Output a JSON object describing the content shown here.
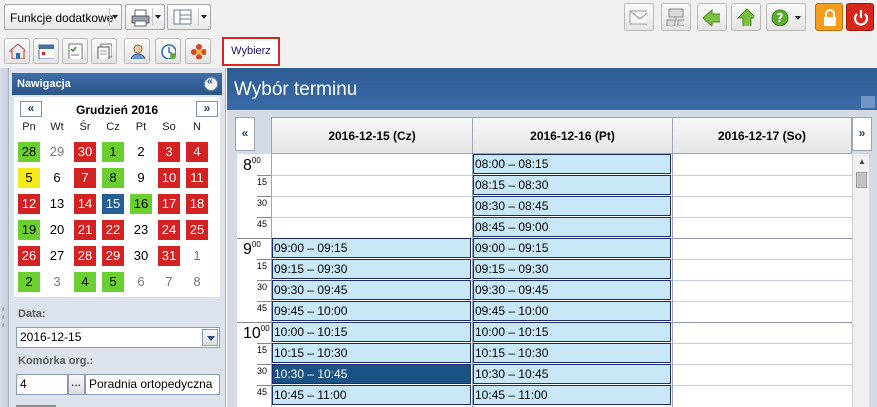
{
  "toolbar": {
    "functions_label": "Funkcje dodatkowe",
    "wybierz_label": "Wybierz"
  },
  "nav": {
    "header": "Nawigacja",
    "calendar": {
      "month_title": "Grudzień 2016",
      "prev": "«",
      "next": "»",
      "weekdays": [
        "Pn",
        "Wt",
        "Śr",
        "Cz",
        "Pt",
        "So",
        "N"
      ],
      "weeks": [
        [
          {
            "d": "28",
            "s": "green"
          },
          {
            "d": "29",
            "s": "other"
          },
          {
            "d": "30",
            "s": "red"
          },
          {
            "d": "1",
            "s": "green"
          },
          {
            "d": "2",
            "s": "plain"
          },
          {
            "d": "3",
            "s": "red"
          },
          {
            "d": "4",
            "s": "red"
          }
        ],
        [
          {
            "d": "5",
            "s": "yellow"
          },
          {
            "d": "6",
            "s": "plain"
          },
          {
            "d": "7",
            "s": "red"
          },
          {
            "d": "8",
            "s": "green"
          },
          {
            "d": "9",
            "s": "plain"
          },
          {
            "d": "10",
            "s": "red"
          },
          {
            "d": "11",
            "s": "red"
          }
        ],
        [
          {
            "d": "12",
            "s": "red"
          },
          {
            "d": "13",
            "s": "plain"
          },
          {
            "d": "14",
            "s": "red"
          },
          {
            "d": "15",
            "s": "sel"
          },
          {
            "d": "16",
            "s": "green"
          },
          {
            "d": "17",
            "s": "red"
          },
          {
            "d": "18",
            "s": "red"
          }
        ],
        [
          {
            "d": "19",
            "s": "green"
          },
          {
            "d": "20",
            "s": "plain"
          },
          {
            "d": "21",
            "s": "red"
          },
          {
            "d": "22",
            "s": "red"
          },
          {
            "d": "23",
            "s": "plain"
          },
          {
            "d": "24",
            "s": "red"
          },
          {
            "d": "25",
            "s": "red"
          }
        ],
        [
          {
            "d": "26",
            "s": "red"
          },
          {
            "d": "27",
            "s": "plain"
          },
          {
            "d": "28",
            "s": "red"
          },
          {
            "d": "29",
            "s": "red"
          },
          {
            "d": "30",
            "s": "plain"
          },
          {
            "d": "31",
            "s": "red"
          },
          {
            "d": "1",
            "s": "other"
          }
        ],
        [
          {
            "d": "2",
            "s": "green"
          },
          {
            "d": "3",
            "s": "other"
          },
          {
            "d": "4",
            "s": "green"
          },
          {
            "d": "5",
            "s": "green"
          },
          {
            "d": "6",
            "s": "other"
          },
          {
            "d": "7",
            "s": "other"
          },
          {
            "d": "8",
            "s": "other"
          }
        ]
      ]
    },
    "date_label": "Data:",
    "date_value": "2016-12-15",
    "unit_label": "Komórka org.:",
    "unit_code": "4",
    "unit_btn": "...",
    "unit_name": "Poradnia ortopedyczna"
  },
  "main": {
    "title": "Wybór terminu",
    "prev": "«",
    "next": "»",
    "columns": [
      {
        "date": "2016-12-15 (Cz)"
      },
      {
        "date": "2016-12-16 (Pt)"
      },
      {
        "date": "2016-12-17 (So)"
      }
    ],
    "hours": [
      {
        "h": "8",
        "m": "00"
      },
      {
        "h": "9",
        "m": "00"
      },
      {
        "h": "10",
        "m": "00"
      }
    ],
    "minutes": [
      "15",
      "30",
      "45"
    ],
    "col1_slots": [
      {
        "row": 4,
        "label": "09:00 – 09:15"
      },
      {
        "row": 5,
        "label": "09:15 – 09:30"
      },
      {
        "row": 6,
        "label": "09:30 – 09:45"
      },
      {
        "row": 7,
        "label": "09:45 – 10:00"
      },
      {
        "row": 8,
        "label": "10:00 – 10:15"
      },
      {
        "row": 9,
        "label": "10:15 – 10:30"
      },
      {
        "row": 10,
        "label": "10:30 – 10:45",
        "selected": true
      },
      {
        "row": 11,
        "label": "10:45 – 11:00"
      }
    ],
    "col2_slots": [
      {
        "row": 0,
        "label": "08:00 – 08:15"
      },
      {
        "row": 1,
        "label": "08:15 – 08:30"
      },
      {
        "row": 2,
        "label": "08:30 – 08:45"
      },
      {
        "row": 3,
        "label": "08:45 – 09:00"
      },
      {
        "row": 4,
        "label": "09:00 – 09:15"
      },
      {
        "row": 5,
        "label": "09:15 – 09:30"
      },
      {
        "row": 6,
        "label": "09:30 – 09:45"
      },
      {
        "row": 7,
        "label": "09:45 – 10:00"
      },
      {
        "row": 8,
        "label": "10:00 – 10:15"
      },
      {
        "row": 9,
        "label": "10:15 – 10:30"
      },
      {
        "row": 10,
        "label": "10:30 – 10:45"
      },
      {
        "row": 11,
        "label": "10:45 – 11:00"
      }
    ]
  },
  "colors": {
    "slot": "#c8e8f7",
    "slot_selected": "#1b5285",
    "day_red": "#d42121",
    "day_green": "#6bcf2f",
    "day_yellow": "#f4ea1c",
    "header_blue": "#2e5c95"
  },
  "icons": {
    "row1_left": [
      "printer-icon",
      "layout-icon"
    ],
    "row1_right": [
      "mail-icon",
      "network-icon",
      "back-arrow-icon",
      "up-arrow-icon",
      "help-icon",
      "lock-icon",
      "power-icon"
    ],
    "row2": [
      "home-icon",
      "calendar-icon",
      "checklist-icon",
      "documents-icon",
      "patient-icon",
      "clock-icon",
      "flower-icon"
    ]
  }
}
